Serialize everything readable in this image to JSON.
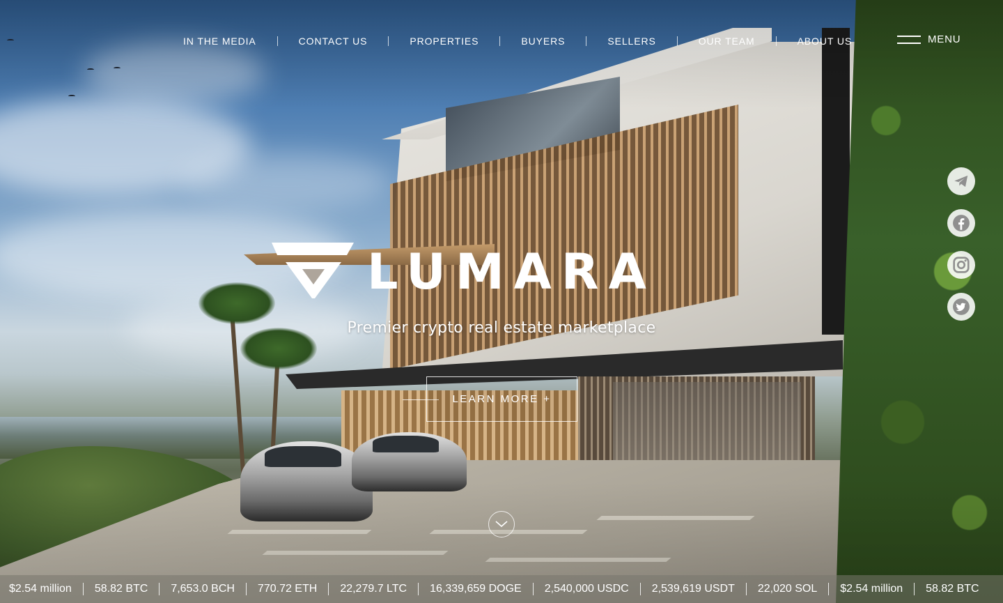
{
  "nav": {
    "items": [
      {
        "label": "IN THE MEDIA"
      },
      {
        "label": "CONTACT US"
      },
      {
        "label": "PROPERTIES"
      },
      {
        "label": "BUYERS"
      },
      {
        "label": "SELLERS"
      },
      {
        "label": "OUR TEAM"
      },
      {
        "label": "ABOUT US"
      }
    ],
    "menu_label": "MENU"
  },
  "hero": {
    "logo_text": "LUMARA",
    "tagline": "Premier crypto real estate marketplace",
    "cta_label": "LEARN MORE +"
  },
  "social": [
    {
      "icon": "telegram-icon"
    },
    {
      "icon": "facebook-icon"
    },
    {
      "icon": "instagram-icon"
    },
    {
      "icon": "twitter-icon"
    }
  ],
  "ticker": [
    "$2.54 million",
    "58.82 BTC",
    "7,653.0 BCH",
    "770.72 ETH",
    "22,279.7 LTC",
    "16,339,659 DOGE",
    "2,540,000 USDC",
    "2,539,619 USDT",
    "22,020 SOL",
    "$2.54 million",
    "58.82 BTC"
  ],
  "colors": {
    "text": "#ffffff",
    "social_bg": "#eaeaea",
    "social_icon": "#9a9a9a"
  }
}
